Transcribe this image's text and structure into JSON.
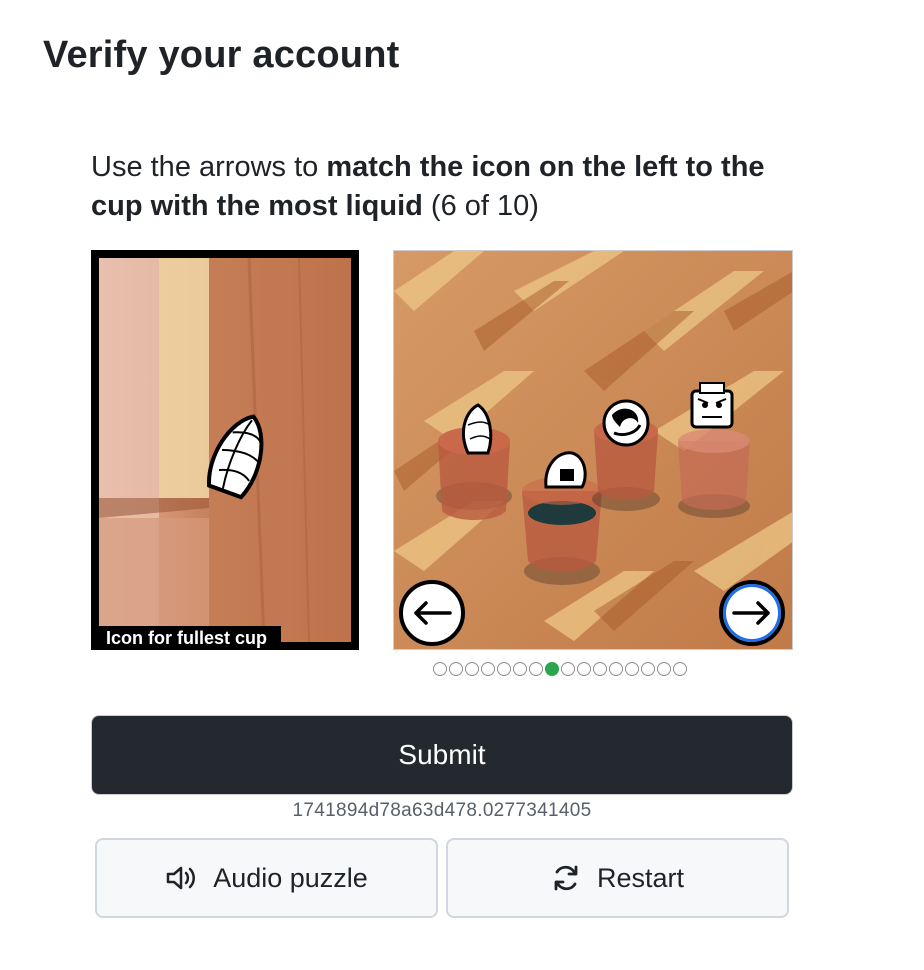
{
  "page": {
    "heading": "Verify your account"
  },
  "instructions": {
    "part1": "Use the arrows to ",
    "bold": "match the icon on the left to the cup with the most liquid",
    "part2": " (6 of 10)"
  },
  "icon_panel": {
    "caption": "Icon for fullest cup",
    "icon": "seashell-icon"
  },
  "cups_panel": {
    "cup_icons": [
      "seashell-icon",
      "helmet-icon",
      "yin-yang-icon",
      "robot-icon"
    ],
    "prev_icon": "arrow-left-icon",
    "next_icon": "arrow-right-icon"
  },
  "progress": {
    "total": 16,
    "current_index": 7
  },
  "submit": {
    "label": "Submit"
  },
  "session_id": "1741894d78a63d478.0277341405",
  "buttons": {
    "audio_label": "Audio puzzle",
    "audio_icon": "speaker-icon",
    "restart_label": "Restart",
    "restart_icon": "refresh-icon"
  },
  "colors": {
    "primary": "#24292f",
    "active_dot": "#2da44e",
    "focus_ring": "#1f6feb"
  }
}
